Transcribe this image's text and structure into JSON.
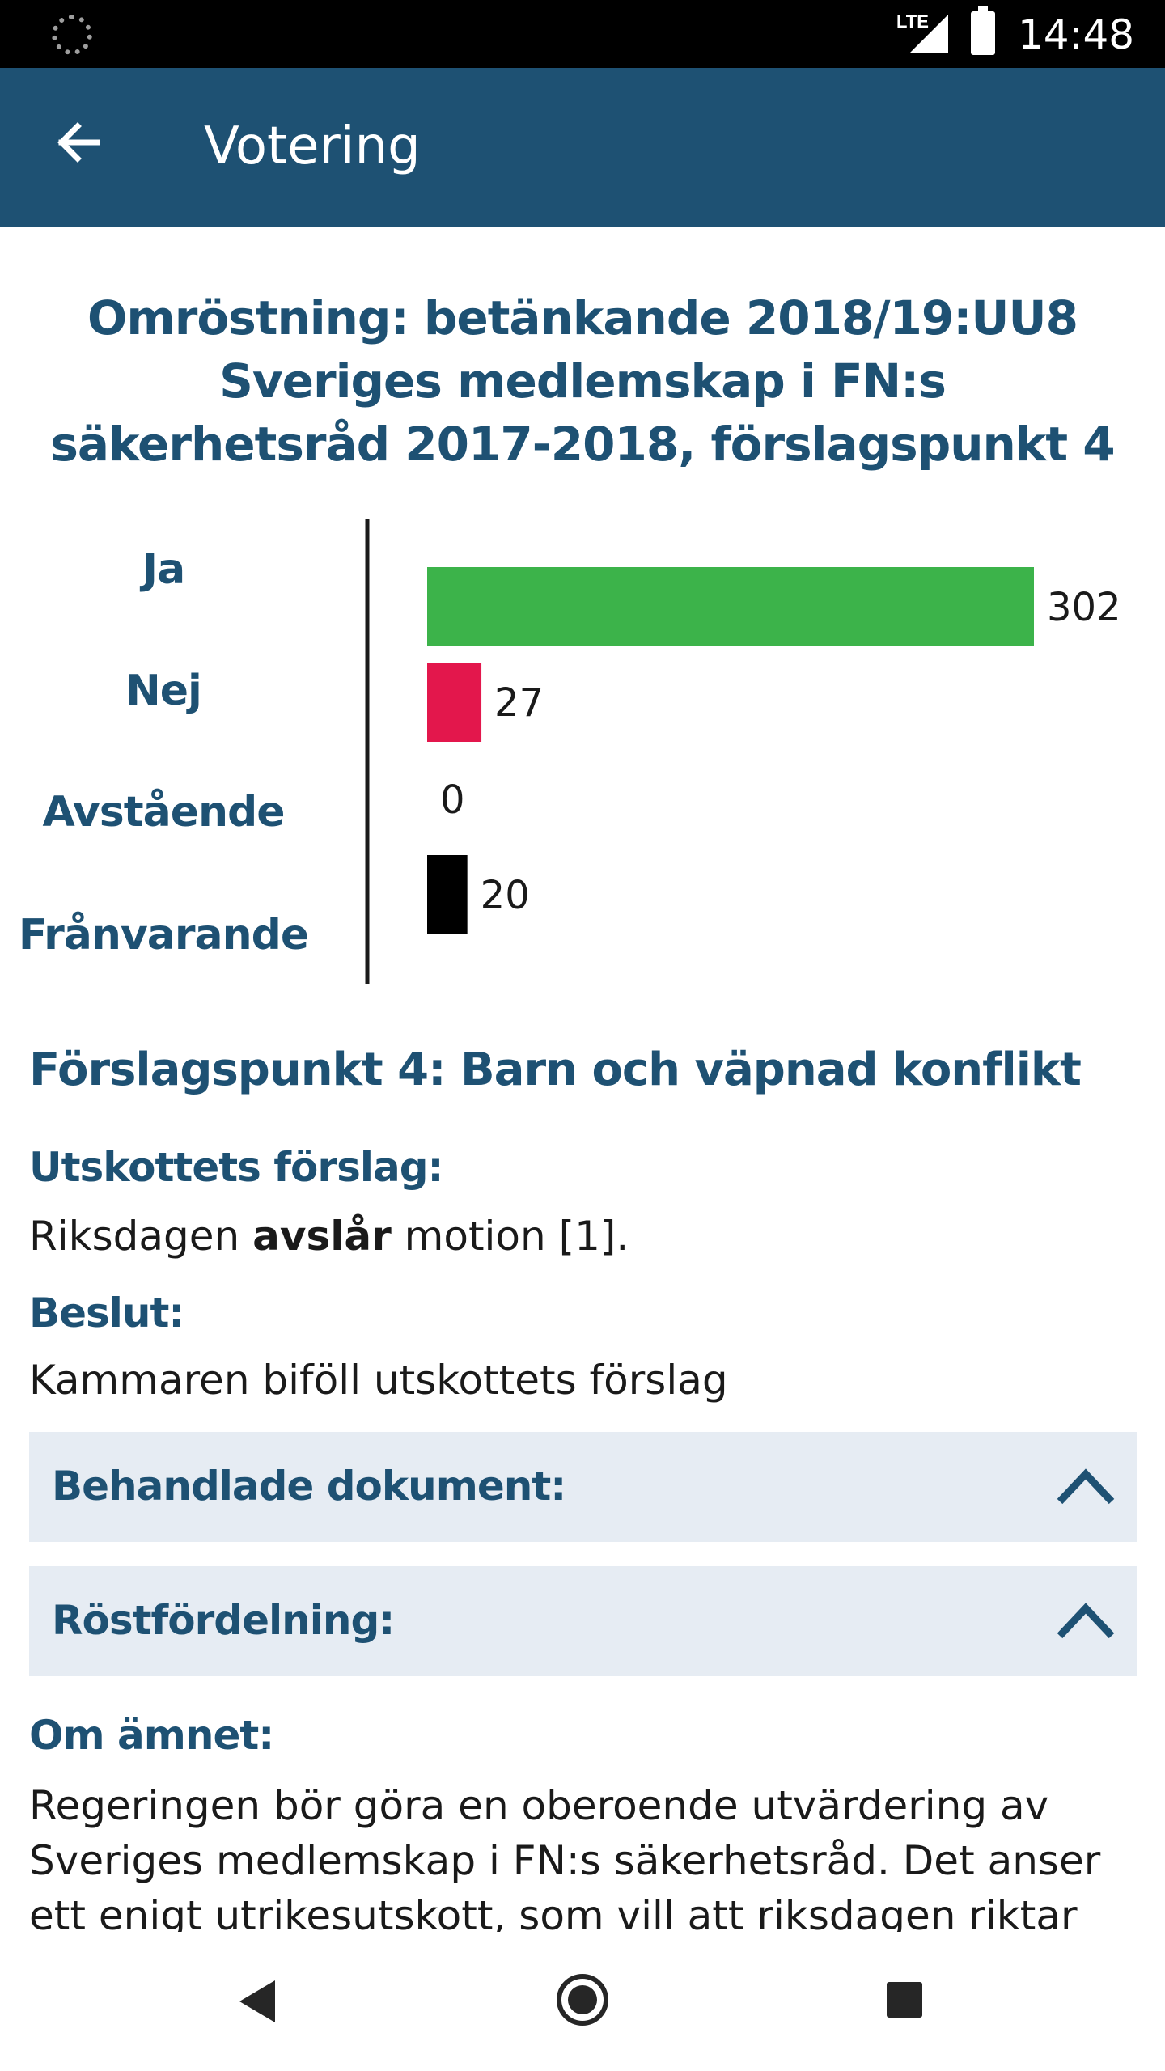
{
  "status_bar": {
    "network": "LTE",
    "time": "14:48",
    "icons": [
      "loading-icon",
      "signal-icon",
      "battery-icon"
    ]
  },
  "app_bar": {
    "title": "Votering",
    "back_icon": "arrow-left-icon"
  },
  "vote": {
    "title": "Omröstning: betänkande 2018/19:UU8 Sveriges medlemskap i FN:s säkerhetsråd 2017-2018, förslagspunkt 4"
  },
  "chart_data": {
    "type": "bar",
    "orientation": "horizontal",
    "categories": [
      "Ja",
      "Nej",
      "Avstående",
      "Frånvarande"
    ],
    "values": [
      302,
      27,
      0,
      20
    ],
    "colors": [
      "#3cb34a",
      "#e3174c",
      "#000000",
      "#000000"
    ],
    "xlim": [
      0,
      302
    ],
    "grid": false,
    "legend": "none"
  },
  "item": {
    "heading": "Förslagspunkt 4: Barn och väpnad konflikt",
    "proposal_label": "Utskottets förslag:",
    "proposal_text_pre": "Riksdagen ",
    "proposal_text_bold": "avslår",
    "proposal_text_post": " motion [1].",
    "decision_label": "Beslut:",
    "decision_text": "Kammaren biföll utskottets förslag"
  },
  "accordions": [
    {
      "label": "Behandlade dokument:",
      "icon": "chevron-up-icon"
    },
    {
      "label": "Röstfördelning:",
      "icon": "chevron-up-icon"
    }
  ],
  "about": {
    "label": "Om ämnet:",
    "text": "Regeringen bör göra en oberoende utvärdering av Sveriges medlemskap i FN:s säkerhetsråd. Det anser ett enigt utrikesutskott, som vill att riksdagen riktar ett"
  },
  "nav_bar": {
    "icons": [
      "nav-back-icon",
      "nav-home-icon",
      "nav-recents-icon"
    ]
  },
  "theme": {
    "primary": "#1e5173",
    "accordion_bg": "#e6ecf3"
  }
}
